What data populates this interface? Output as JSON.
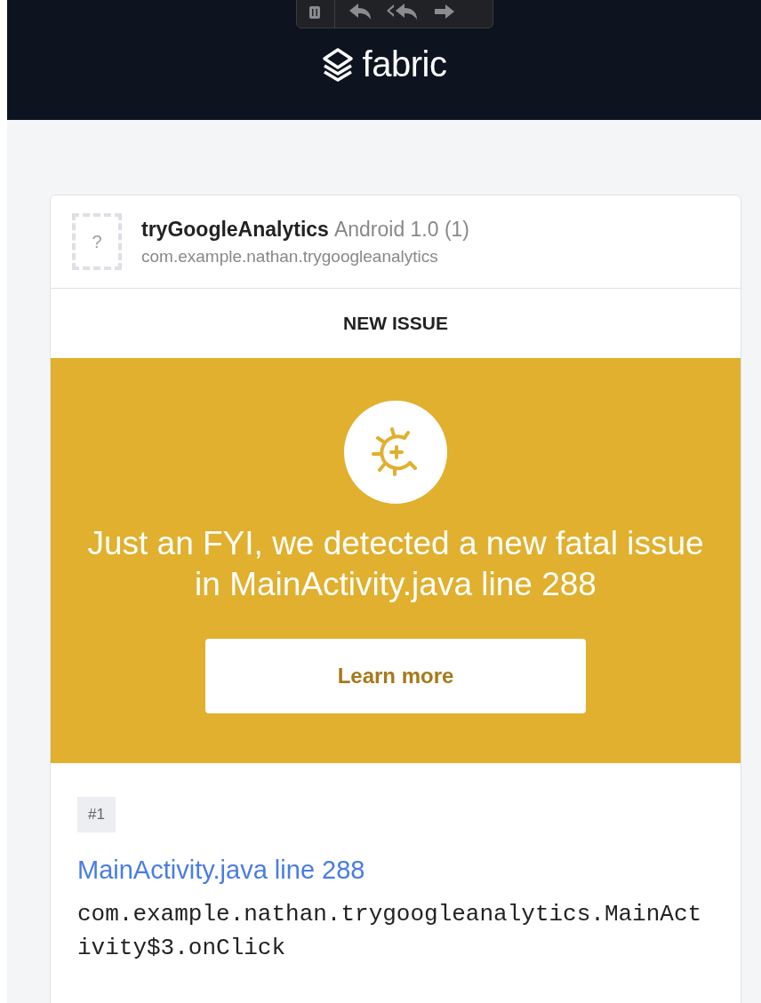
{
  "header": {
    "brand": "fabric"
  },
  "toolbar": {
    "buttons": [
      {
        "kind": "trash"
      },
      {
        "kind": "reply"
      },
      {
        "kind": "reply-all"
      },
      {
        "kind": "forward"
      }
    ]
  },
  "app": {
    "name": "tryGoogleAnalytics",
    "platform": "Android 1.0 (1)",
    "package": "com.example.nathan.trygoogleanalytics",
    "icon_placeholder": "?"
  },
  "section_title": "NEW ISSUE",
  "banner": {
    "message": "Just an FYI, we detected a new fatal issue in MainActivity.java line 288",
    "button": "Learn more"
  },
  "issue": {
    "number": "#1",
    "title": "MainActivity.java line 288",
    "method": "com.example.nathan.trygoogleanalytics.MainActivity$3.onClick"
  }
}
